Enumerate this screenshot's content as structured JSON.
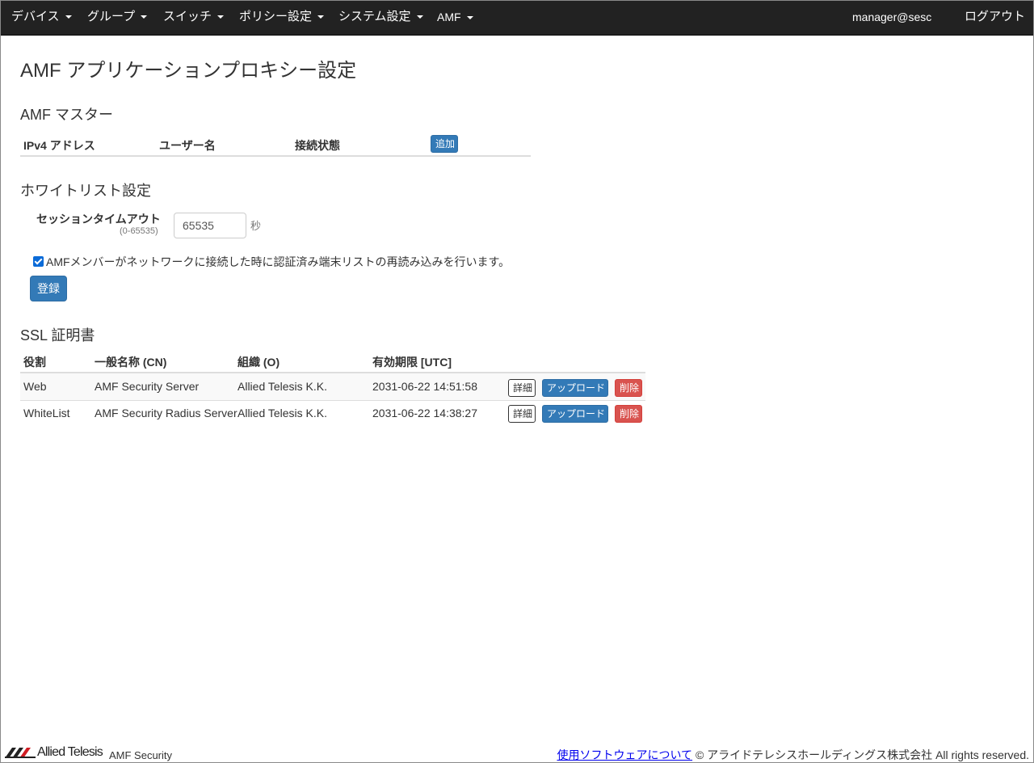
{
  "nav": {
    "items": [
      "デバイス",
      "グループ",
      "スイッチ",
      "ポリシー設定",
      "システム設定",
      "AMF"
    ],
    "user": "manager@sesc",
    "logout": "ログアウト"
  },
  "page": {
    "title": "AMF アプリケーションプロキシー設定"
  },
  "amf_master": {
    "heading": "AMF マスター",
    "columns": [
      "IPv4 アドレス",
      "ユーザー名",
      "接続状態"
    ],
    "add_button": "追加"
  },
  "whitelist": {
    "heading": "ホワイトリスト設定",
    "timeout_label": "セッションタイムアウト",
    "timeout_range": "(0-65535)",
    "timeout_value": "65535",
    "timeout_unit": "秒",
    "reload_checked": true,
    "reload_label": "AMFメンバーがネットワークに接続した時に認証済み端末リストの再読み込みを行います。",
    "submit": "登録"
  },
  "ssl": {
    "heading": "SSL 証明書",
    "columns": [
      "役割",
      "一般名称 (CN)",
      "組織 (O)",
      "有効期限 [UTC]"
    ],
    "rows": [
      {
        "role": "Web",
        "cn": "AMF Security Server",
        "org": "Allied Telesis K.K.",
        "expires": "2031-06-22 14:51:58"
      },
      {
        "role": "WhiteList",
        "cn": "AMF Security Radius Server",
        "org": "Allied Telesis K.K.",
        "expires": "2031-06-22 14:38:27"
      }
    ],
    "detail_button": "詳細",
    "upload_button": "アップロード",
    "delete_button": "削除"
  },
  "footer": {
    "brand": "Allied Telesis",
    "product": "AMF Security",
    "software_link": "使用ソフトウェアについて",
    "copyright": "© アライドテレシスホールディングス株式会社 All rights reserved."
  },
  "colors": {
    "navbar_bg": "#222222",
    "primary": "#337ab7",
    "danger": "#d9534f",
    "checkbox": "#0b6bd8"
  }
}
